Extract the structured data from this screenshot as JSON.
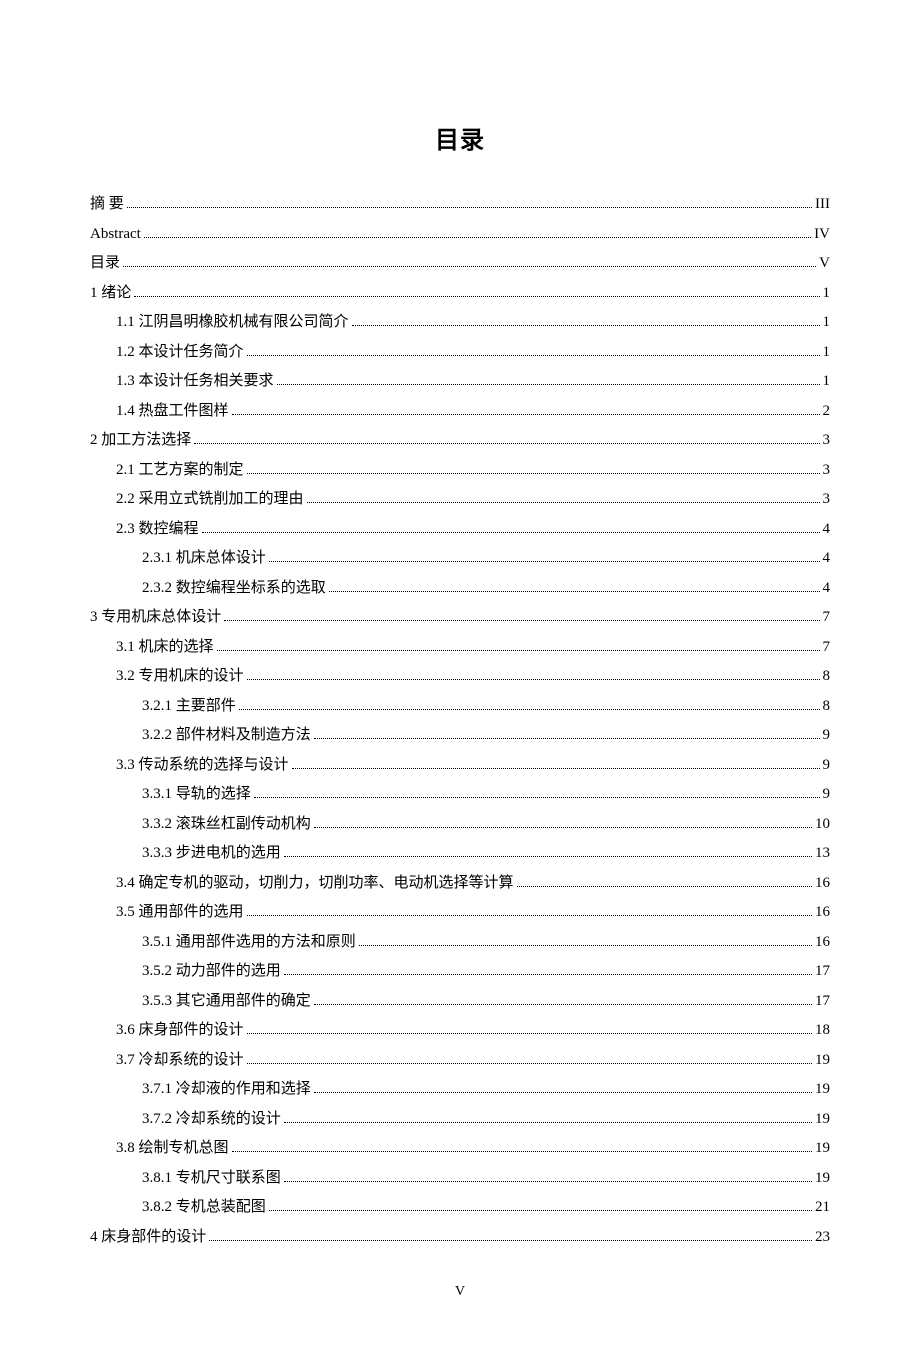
{
  "title": "目录",
  "page_number": "V",
  "entries": [
    {
      "label": "摘   要",
      "page": "III",
      "level": 0
    },
    {
      "label": "Abstract",
      "page": "IV",
      "level": 0
    },
    {
      "label": "目录",
      "page": "V",
      "level": 0
    },
    {
      "label": "1  绪论",
      "page": "1",
      "level": 0
    },
    {
      "label": "1.1  江阴昌明橡胶机械有限公司简介",
      "page": "1",
      "level": 1
    },
    {
      "label": "1.2  本设计任务简介",
      "page": "1",
      "level": 1
    },
    {
      "label": "1.3  本设计任务相关要求",
      "page": "1",
      "level": 1
    },
    {
      "label": "1.4  热盘工件图样",
      "page": "2",
      "level": 1
    },
    {
      "label": "2  加工方法选择",
      "page": "3",
      "level": 0
    },
    {
      "label": "2.1  工艺方案的制定",
      "page": "3",
      "level": 1
    },
    {
      "label": "2.2  采用立式铣削加工的理由",
      "page": "3",
      "level": 1
    },
    {
      "label": "2.3 数控编程",
      "page": "4",
      "level": 1
    },
    {
      "label": "2.3.1 机床总体设计",
      "page": "4",
      "level": 2
    },
    {
      "label": "2.3.2  数控编程坐标系的选取",
      "page": "4",
      "level": 2
    },
    {
      "label": "3  专用机床总体设计",
      "page": "7",
      "level": 0
    },
    {
      "label": "3.1  机床的选择",
      "page": "7",
      "level": 1
    },
    {
      "label": "3.2  专用机床的设计",
      "page": "8",
      "level": 1
    },
    {
      "label": "3.2.1  主要部件",
      "page": "8",
      "level": 2
    },
    {
      "label": "3.2.2  部件材料及制造方法",
      "page": "9",
      "level": 2
    },
    {
      "label": "3.3  传动系统的选择与设计",
      "page": "9",
      "level": 1
    },
    {
      "label": "3.3.1  导轨的选择",
      "page": "9",
      "level": 2
    },
    {
      "label": "3.3.2  滚珠丝杠副传动机构",
      "page": "10",
      "level": 2
    },
    {
      "label": "3.3.3  步进电机的选用",
      "page": "13",
      "level": 2
    },
    {
      "label": "3.4  确定专机的驱动，切削力，切削功率、电动机选择等计算",
      "page": "16",
      "level": 1
    },
    {
      "label": "3.5  通用部件的选用",
      "page": "16",
      "level": 1
    },
    {
      "label": "3.5.1  通用部件选用的方法和原则",
      "page": "16",
      "level": 2
    },
    {
      "label": "3.5.2  动力部件的选用",
      "page": "17",
      "level": 2
    },
    {
      "label": "3.5.3  其它通用部件的确定",
      "page": "17",
      "level": 2
    },
    {
      "label": "3.6  床身部件的设计",
      "page": "18",
      "level": 1
    },
    {
      "label": "3.7  冷却系统的设计",
      "page": "19",
      "level": 1
    },
    {
      "label": "3.7.1  冷却液的作用和选择",
      "page": "19",
      "level": 2
    },
    {
      "label": "3.7.2  冷却系统的设计",
      "page": "19",
      "level": 2
    },
    {
      "label": "3.8  绘制专机总图",
      "page": "19",
      "level": 1
    },
    {
      "label": "3.8.1 专机尺寸联系图",
      "page": "19",
      "level": 2
    },
    {
      "label": "3.8.2  专机总装配图",
      "page": "21",
      "level": 2
    },
    {
      "label": "4  床身部件的设计",
      "page": "23",
      "level": 0
    }
  ]
}
